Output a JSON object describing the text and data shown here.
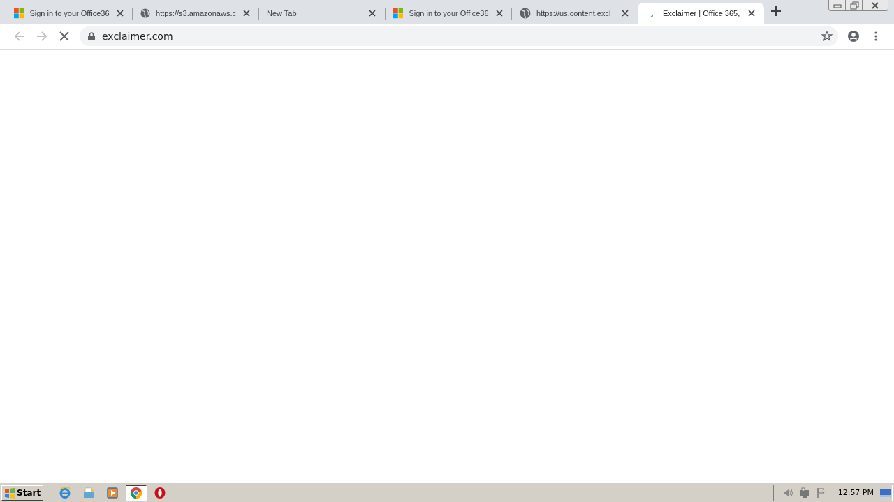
{
  "tabs": [
    {
      "title": "Sign in to your Office36",
      "kind": "microsoft",
      "selected": false
    },
    {
      "title": "https://s3.amazonaws.c",
      "kind": "site",
      "selected": false
    },
    {
      "title": "New Tab",
      "kind": "blank",
      "selected": false
    },
    {
      "title": "Sign in to your Office36",
      "kind": "microsoft",
      "selected": false
    },
    {
      "title": "https://us.content.excl",
      "kind": "site",
      "selected": false
    },
    {
      "title": "Exclaimer | Office 365,",
      "kind": "loading",
      "selected": true
    }
  ],
  "address_bar": {
    "value": "exclaimer.com"
  },
  "taskbar": {
    "start": "Start",
    "apps": [
      {
        "kind": "ie",
        "selected": false
      },
      {
        "kind": "folder",
        "selected": false
      },
      {
        "kind": "media",
        "selected": false
      },
      {
        "kind": "chrome",
        "selected": true
      },
      {
        "kind": "opera",
        "selected": false
      }
    ],
    "clock": "12:57 PM"
  }
}
